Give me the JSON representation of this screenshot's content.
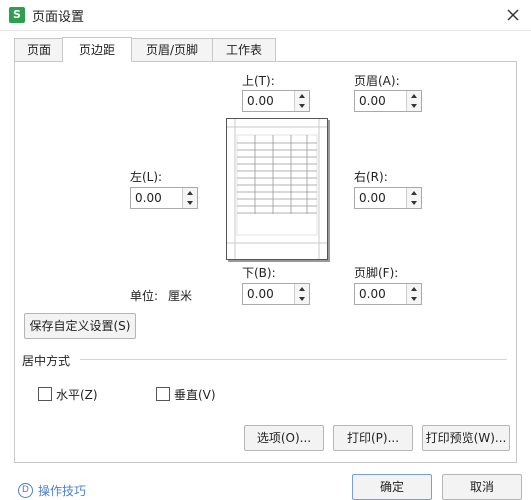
{
  "window": {
    "app_icon_letter": "S",
    "title": "页面设置",
    "close_icon": "close-icon"
  },
  "tabs": [
    {
      "label": "页面",
      "active": false
    },
    {
      "label": "页边距",
      "active": true
    },
    {
      "label": "页眉/页脚",
      "active": false
    },
    {
      "label": "工作表",
      "active": false
    }
  ],
  "margins": {
    "top_label": "上(T):",
    "top_value": "0.00",
    "header_label": "页眉(A):",
    "header_value": "0.00",
    "left_label": "左(L):",
    "left_value": "0.00",
    "right_label": "右(R):",
    "right_value": "0.00",
    "bottom_label": "下(B):",
    "bottom_value": "0.00",
    "footer_label": "页脚(F):",
    "footer_value": "0.00",
    "unit_label": "单位:",
    "unit_value": "厘米"
  },
  "save_custom_button": "保存自定义设置(S)",
  "center": {
    "section_label": "居中方式",
    "horizontal_label": "水平(Z)",
    "horizontal_checked": false,
    "vertical_label": "垂直(V)",
    "vertical_checked": false
  },
  "buttons": {
    "options": "选项(O)...",
    "print": "打印(P)...",
    "print_preview": "打印预览(W)..."
  },
  "footer": {
    "tips_label": "操作技巧",
    "ok": "确定",
    "cancel": "取消"
  },
  "colors": {
    "accent": "#4a7fd0",
    "app_icon": "#2e9e4f"
  }
}
